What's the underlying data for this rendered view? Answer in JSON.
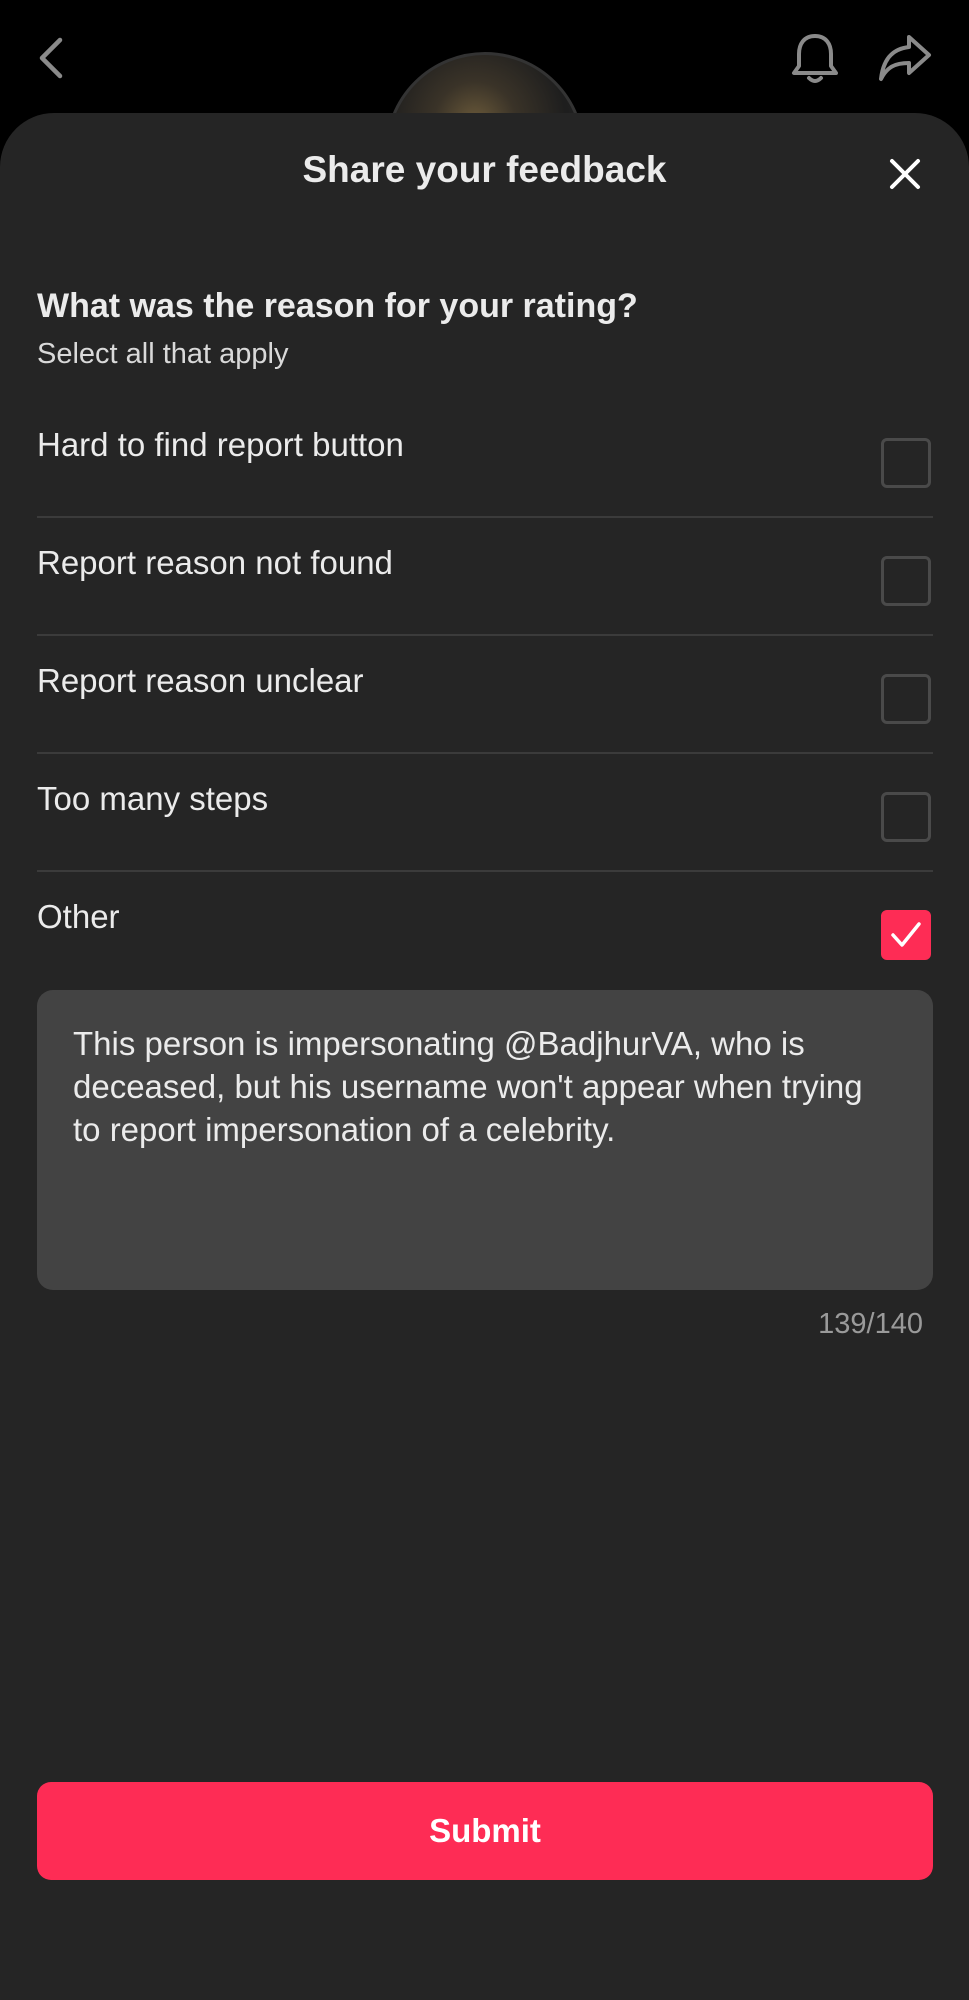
{
  "topbar": {
    "back_icon": "chevron-left-icon",
    "bell_icon": "bell-icon",
    "share_icon": "share-icon"
  },
  "sheet": {
    "title": "Share your feedback",
    "close_icon": "close-icon"
  },
  "question": {
    "title": "What was the reason for your rating?",
    "subtitle": "Select all that apply"
  },
  "options": [
    {
      "label": "Hard to find report button",
      "checked": false
    },
    {
      "label": "Report reason not found",
      "checked": false
    },
    {
      "label": "Report reason unclear",
      "checked": false
    },
    {
      "label": "Too many steps",
      "checked": false
    },
    {
      "label": "Other",
      "checked": true
    }
  ],
  "comment": {
    "value": "This person is impersonating @BadjhurVA, who is deceased, but his username won't appear when trying to report impersonation of a celebrity.",
    "counter": "139/140"
  },
  "submit_label": "Submit",
  "colors": {
    "accent": "#fe2c55",
    "sheet_bg": "#252525",
    "input_bg": "#434343"
  }
}
